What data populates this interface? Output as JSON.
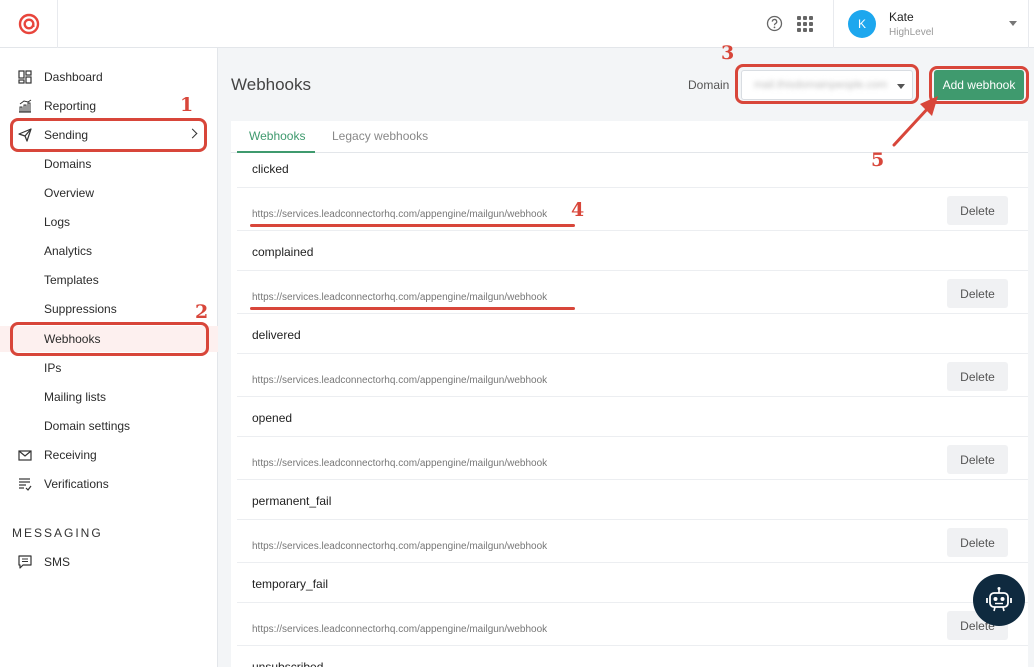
{
  "user": {
    "initial": "K",
    "name": "Kate",
    "org": "HighLevel"
  },
  "sidebar": {
    "items": [
      {
        "label": "Dashboard",
        "icon": "dashboard-icon"
      },
      {
        "label": "Reporting",
        "icon": "reporting-icon"
      },
      {
        "label": "Sending",
        "icon": "send-icon"
      },
      {
        "label": "Domains"
      },
      {
        "label": "Overview"
      },
      {
        "label": "Logs"
      },
      {
        "label": "Analytics"
      },
      {
        "label": "Templates"
      },
      {
        "label": "Suppressions"
      },
      {
        "label": "Webhooks"
      },
      {
        "label": "IPs"
      },
      {
        "label": "Mailing lists"
      },
      {
        "label": "Domain settings"
      },
      {
        "label": "Receiving",
        "icon": "mail-icon"
      },
      {
        "label": "Verifications",
        "icon": "verifications-icon"
      }
    ],
    "section_heading": "MESSAGING",
    "sms_label": "SMS"
  },
  "main": {
    "title": "Webhooks",
    "domain_label": "Domain",
    "domain_value": "mail.thisdomainpeople.com",
    "add_button": "Add webhook",
    "tabs": [
      {
        "label": "Webhooks",
        "active": true
      },
      {
        "label": "Legacy webhooks",
        "active": false
      }
    ],
    "delete_label": "Delete",
    "webhooks": [
      {
        "event": "clicked",
        "url": "https://services.leadconnectorhq.com/appengine/mailgun/webhook"
      },
      {
        "event": "complained",
        "url": "https://services.leadconnectorhq.com/appengine/mailgun/webhook"
      },
      {
        "event": "delivered",
        "url": "https://services.leadconnectorhq.com/appengine/mailgun/webhook"
      },
      {
        "event": "opened",
        "url": "https://services.leadconnectorhq.com/appengine/mailgun/webhook"
      },
      {
        "event": "permanent_fail",
        "url": "https://services.leadconnectorhq.com/appengine/mailgun/webhook"
      },
      {
        "event": "temporary_fail",
        "url": "https://services.leadconnectorhq.com/appengine/mailgun/webhook"
      },
      {
        "event": "unsubscribed",
        "url": ""
      }
    ]
  },
  "annotations": [
    "1",
    "2",
    "3",
    "4",
    "5"
  ],
  "colors": {
    "accent_green": "#3f9a6e",
    "annotation_red": "#d8463a",
    "avatar_blue": "#1da7ee"
  }
}
